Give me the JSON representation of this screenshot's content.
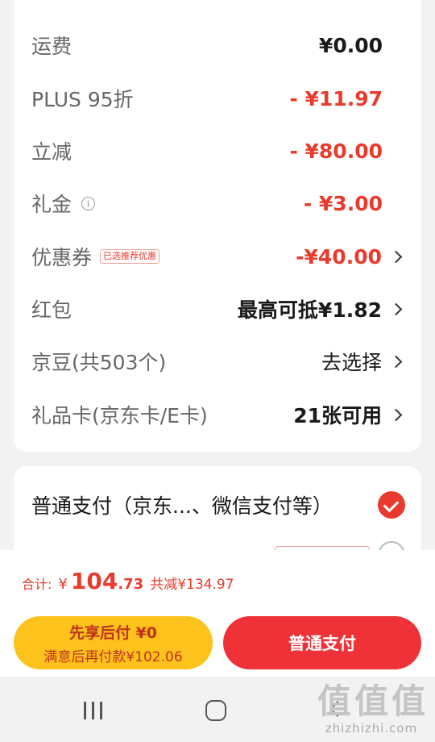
{
  "fees": [
    {
      "label": "运费",
      "value": "¥0.00",
      "style": "dark",
      "chevron": false
    },
    {
      "label": "PLUS 95折",
      "value": "- ¥11.97",
      "style": "red",
      "chevron": false
    },
    {
      "label": "立减",
      "value": "- ¥80.00",
      "style": "red",
      "chevron": false
    },
    {
      "label": "礼金",
      "value": "- ¥3.00",
      "style": "red",
      "chevron": false,
      "info_icon": "info-icon"
    },
    {
      "label": "优惠券",
      "tag": "已选推荐优惠",
      "value": "-¥40.00",
      "style": "red",
      "chevron": true
    },
    {
      "label": "红包",
      "value": "最高可抵¥1.82",
      "style": "dark-normal",
      "chevron": true
    },
    {
      "label": "京豆(共503个)",
      "value": "去选择",
      "style": "normal",
      "chevron": true
    },
    {
      "label": "礼品卡(京东卡/E卡)",
      "value": "21张可用",
      "style": "dark",
      "chevron": true
    }
  ],
  "payment": {
    "option1": "普通支付（京东...、微信支付等）",
    "option1_selected": true
  },
  "summary": {
    "total_label": "合计:",
    "currency": "¥",
    "total_int": "104",
    "total_dec": ".73",
    "saved": "共减¥134.97"
  },
  "buttons": {
    "pay_later_title": "先享后付 ¥0",
    "pay_later_sub": "满意后再付款¥102.06",
    "pay_normal": "普通支付"
  },
  "watermark": {
    "logo": "值",
    "site": "zhizhizhi.com"
  },
  "colors": {
    "accent_red": "#e93b2d",
    "pay_button": "#ee3238",
    "pay_later_button": "#fdc21b"
  }
}
